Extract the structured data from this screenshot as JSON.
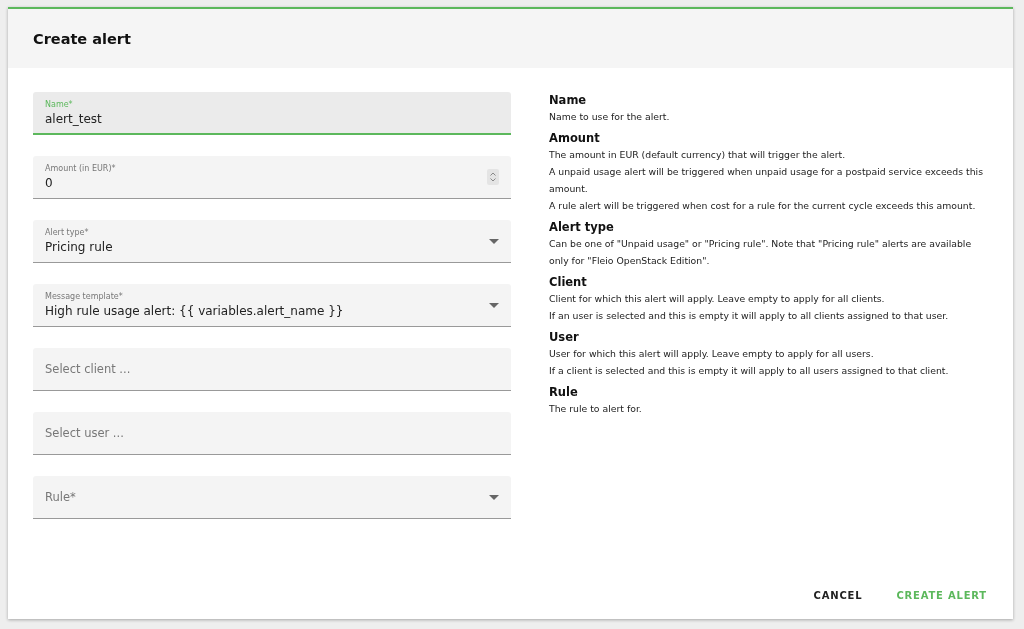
{
  "dialog": {
    "title": "Create alert"
  },
  "fields": [
    {
      "kind": "text",
      "label": "Name*",
      "value": "alert_test",
      "focused": true
    },
    {
      "kind": "number",
      "label": "Amount (in EUR)*",
      "value": "0",
      "focused": false
    },
    {
      "kind": "select",
      "label": "Alert type*",
      "value": "Pricing rule",
      "focused": false
    },
    {
      "kind": "select",
      "label": "Message template*",
      "value": "High rule usage alert: {{ variables.alert_name }}",
      "focused": false
    },
    {
      "kind": "autocomplete",
      "placeholder": "Select client ...",
      "focused": false
    },
    {
      "kind": "autocomplete",
      "placeholder": "Select user ...",
      "focused": false
    },
    {
      "kind": "select",
      "placeholder": "Rule*",
      "focused": false
    }
  ],
  "help": [
    {
      "title": "Name",
      "paragraphs": [
        "Name to use for the alert."
      ]
    },
    {
      "title": "Amount",
      "paragraphs": [
        "The amount in EUR (default currency) that will trigger the alert.",
        "A unpaid usage alert will be triggered when unpaid usage for a postpaid service exceeds this amount.",
        "A rule alert will be triggered when cost for a rule for the current cycle exceeds this amount."
      ]
    },
    {
      "title": "Alert type",
      "paragraphs": [
        "Can be one of \"Unpaid usage\" or \"Pricing rule\". Note that \"Pricing rule\" alerts are available only for \"Fleio OpenStack Edition\"."
      ]
    },
    {
      "title": "Client",
      "paragraphs": [
        "Client for which this alert will apply. Leave empty to apply for all clients.",
        "If an user is selected and this is empty it will apply to all clients assigned to that user."
      ]
    },
    {
      "title": "User",
      "paragraphs": [
        "User for which this alert will apply. Leave empty to apply for all users.",
        "If a client is selected and this is empty it will apply to all users assigned to that client."
      ]
    },
    {
      "title": "Rule",
      "paragraphs": [
        "The rule to alert for."
      ]
    }
  ],
  "buttons": [
    {
      "kind": "plain",
      "label": "CANCEL"
    },
    {
      "kind": "primary",
      "label": "CREATE ALERT"
    }
  ]
}
